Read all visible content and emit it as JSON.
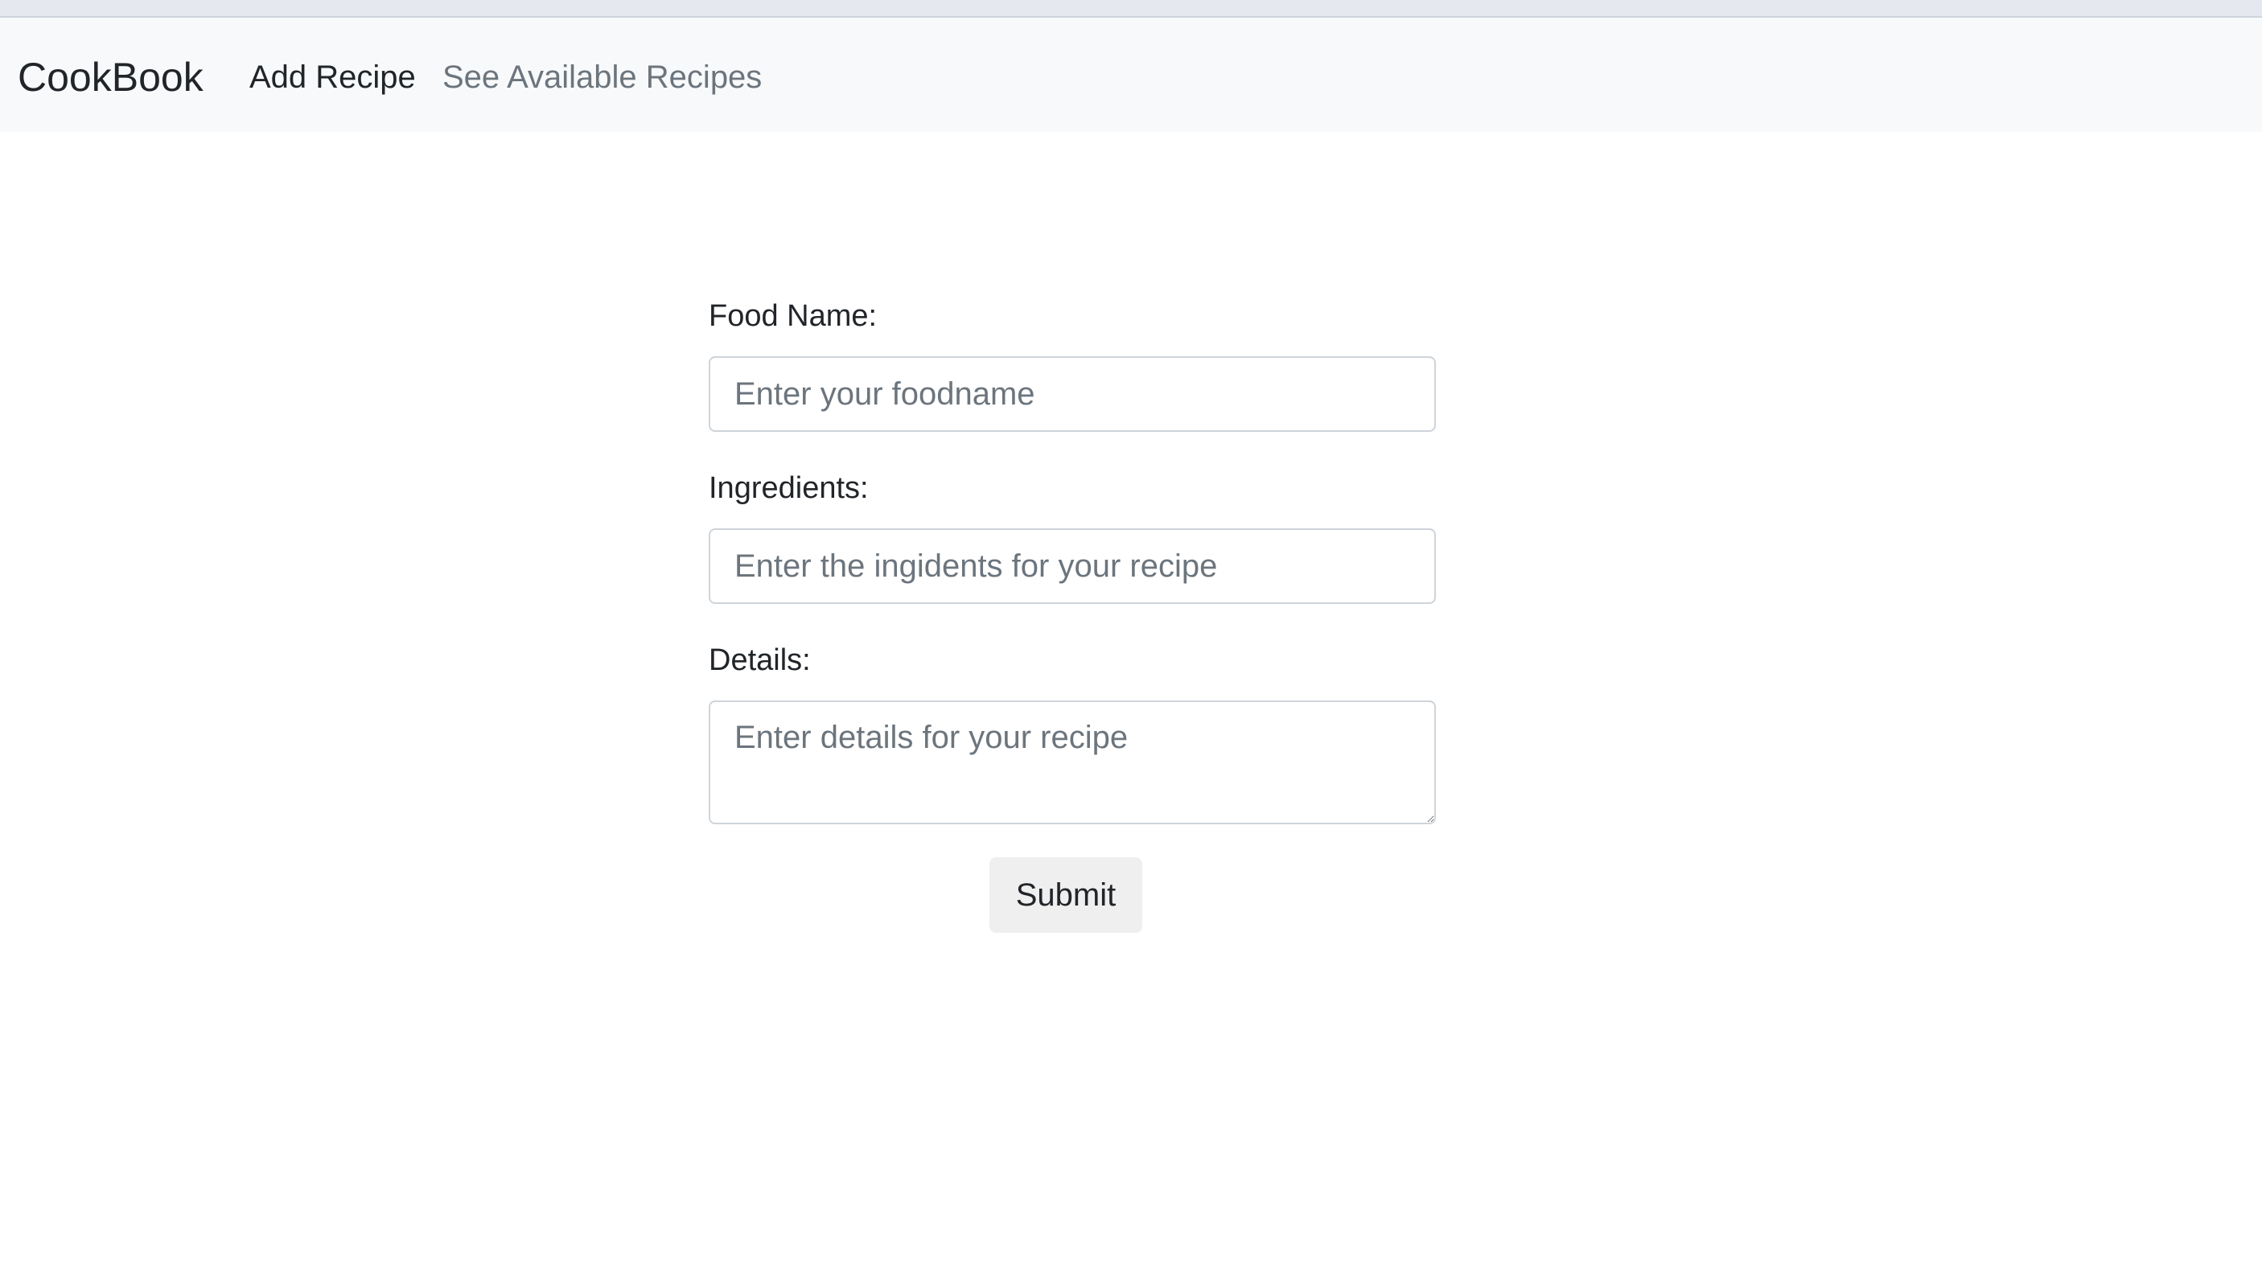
{
  "navbar": {
    "brand": "CookBook",
    "links": [
      {
        "label": "Add Recipe",
        "active": true
      },
      {
        "label": "See Available Recipes",
        "active": false
      }
    ]
  },
  "form": {
    "food_name": {
      "label": "Food Name:",
      "placeholder": "Enter your foodname",
      "value": ""
    },
    "ingredients": {
      "label": "Ingredients:",
      "placeholder": "Enter the ingidents for your recipe",
      "value": ""
    },
    "details": {
      "label": "Details:",
      "placeholder": "Enter details for your recipe",
      "value": ""
    },
    "submit_label": "Submit"
  },
  "colors": {
    "navbar_bg": "#f8f9fa",
    "active_link": "#212529",
    "inactive_link": "#6c757d",
    "input_border": "#ced4da",
    "button_bg": "#efefef"
  }
}
